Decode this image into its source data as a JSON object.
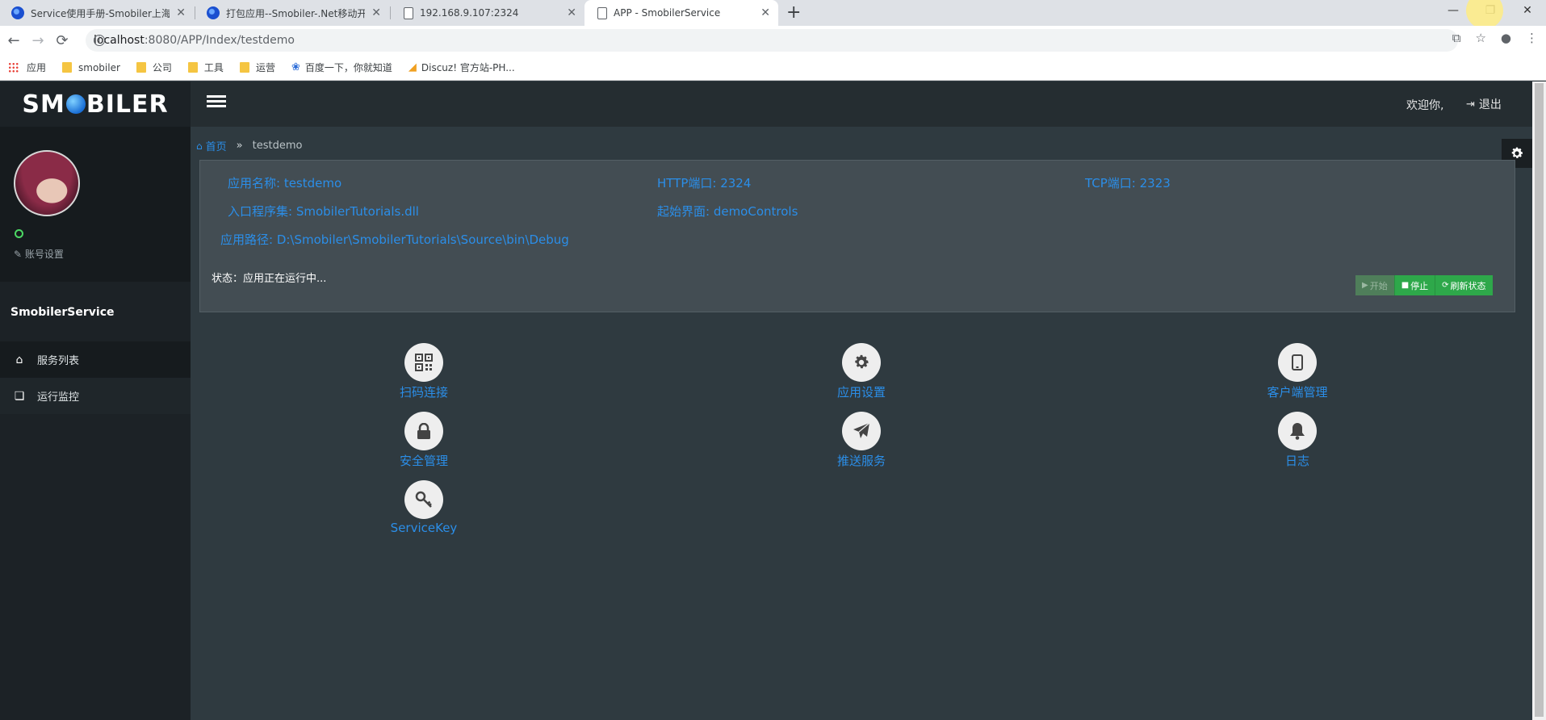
{
  "browser": {
    "tabs": [
      {
        "title": "Service使用手册-Smobiler上海",
        "icon": "smobiler-favicon"
      },
      {
        "title": "打包应用--Smobiler-.Net移动开",
        "icon": "smobiler-favicon"
      },
      {
        "title": "192.168.9.107:2324",
        "icon": "page-icon"
      },
      {
        "title": "APP - SmobilerService",
        "icon": "page-icon",
        "active": true
      }
    ],
    "address": {
      "host": "localhost",
      "path": ":8080/APP/Index/testdemo"
    },
    "bookmarks": [
      {
        "label": "应用",
        "icon": "apps-grid-icon"
      },
      {
        "label": "smobiler",
        "icon": "folder-icon"
      },
      {
        "label": "公司",
        "icon": "folder-icon"
      },
      {
        "label": "工具",
        "icon": "folder-icon"
      },
      {
        "label": "运营",
        "icon": "folder-icon"
      },
      {
        "label": "百度一下，你就知道",
        "icon": "baidu-paw-icon"
      },
      {
        "label": "Discuz! 官方站-PH...",
        "icon": "discuz-icon"
      }
    ]
  },
  "app": {
    "logo": {
      "pre": "SM",
      "post": "BILER"
    },
    "header": {
      "welcome": "欢迎你,",
      "logout": "退出"
    },
    "sidebar": {
      "account_settings": "账号设置",
      "service_name": "SmobilerService",
      "items": [
        {
          "label": "服务列表",
          "icon": "home-icon"
        },
        {
          "label": "运行监控",
          "icon": "copy-icon"
        }
      ]
    },
    "breadcrumb": {
      "home": "首页",
      "sep": "»",
      "current": "testdemo"
    },
    "info": {
      "app_name": "应用名称: testdemo",
      "http_port": "HTTP端口: 2324",
      "tcp_port": "TCP端口: 2323",
      "entry_assembly": "入口程序集: SmobilerTutorials.dll",
      "start_page": "起始界面: demoControls",
      "app_path": "应用路径: D:\\Smobiler\\SmobilerTutorials\\Source\\bin\\Debug",
      "status": "状态：应用正在运行中..."
    },
    "buttons": {
      "start": "开始",
      "stop": "停止",
      "refresh": "刷新状态"
    },
    "features": [
      {
        "label": "扫码连接",
        "icon": "qrcode-icon"
      },
      {
        "label": "应用设置",
        "icon": "gear-icon"
      },
      {
        "label": "客户端管理",
        "icon": "mobile-icon"
      },
      {
        "label": "安全管理",
        "icon": "lock-icon"
      },
      {
        "label": "推送服务",
        "icon": "paper-plane-icon"
      },
      {
        "label": "日志",
        "icon": "bell-icon"
      },
      {
        "label": "ServiceKey",
        "icon": "key-icon"
      }
    ],
    "colors": {
      "link": "#2b8ee8",
      "button": "#2ea84a",
      "background": "#2f3a40",
      "sidebar": "#1c2226"
    }
  }
}
